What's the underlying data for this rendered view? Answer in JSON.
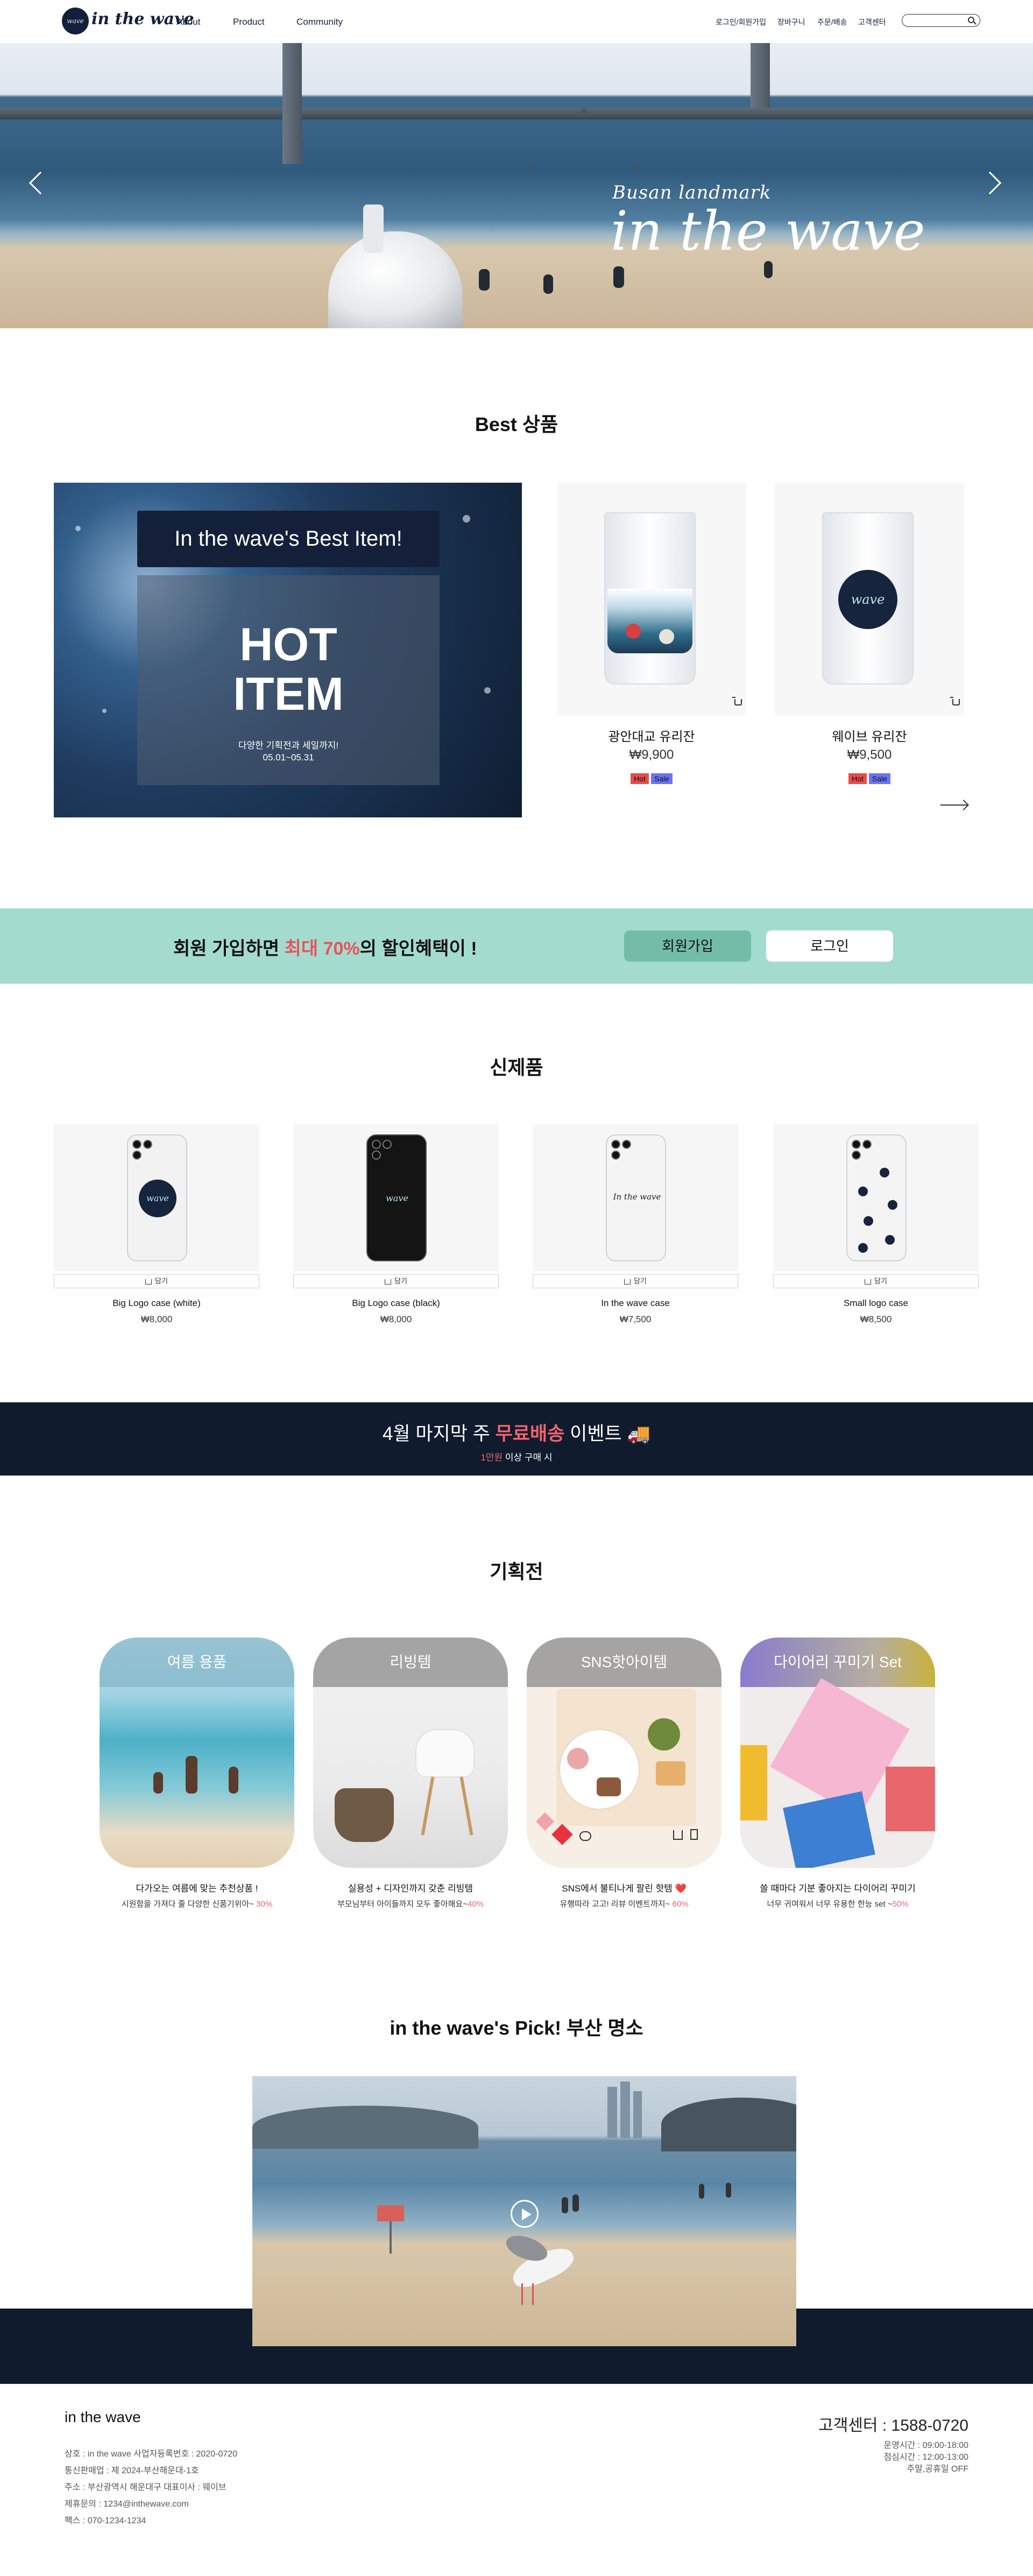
{
  "header": {
    "logo_text": "in the wave",
    "logo_badge": "wave",
    "nav": [
      "About",
      "Product",
      "Community"
    ],
    "util": [
      "로그인/회원가입",
      "장바구니",
      "주문/배송",
      "고객센터"
    ],
    "search_placeholder": ""
  },
  "hero": {
    "caption_small": "Busan landmark",
    "caption_big": "in the wave"
  },
  "best": {
    "title": "Best 상품",
    "banner_pill": "In the wave's Best Item!",
    "banner_hot": "HOT\nITEM",
    "banner_hot_line1": "HOT",
    "banner_hot_line2": "ITEM",
    "banner_sub1": "다양한 기획전과 세일까지!",
    "banner_sub2": "05.01~05.31",
    "products": [
      {
        "name": "광안대교 유리잔",
        "price": "₩9,900",
        "tags": [
          "Hot",
          "Sale"
        ]
      },
      {
        "name": "웨이브 유리잔",
        "price": "₩9,500",
        "tags": [
          "Hot",
          "Sale"
        ]
      }
    ],
    "glass_badge": "wave"
  },
  "member": {
    "text_before": "회원 가입하면 ",
    "text_highlight": "최대 70%",
    "text_after": "의 할인혜택이 !",
    "join_label": "회원가입",
    "login_label": "로그인"
  },
  "new_products": {
    "title": "신제품",
    "cart_label": "담기",
    "items": [
      {
        "name": "Big Logo case (white)",
        "price": "₩8,000",
        "logo": "wave"
      },
      {
        "name": "Big Logo case (black)",
        "price": "₩8,000",
        "logo": "wave"
      },
      {
        "name": "In the wave case",
        "price": "₩7,500",
        "logo": "In the wave"
      },
      {
        "name": "Small logo case",
        "price": "₩8,500",
        "logo": ""
      }
    ]
  },
  "event": {
    "title_before": "4월 마지막 주 ",
    "title_highlight": "무료배송",
    "title_after": " 이벤트 🚚",
    "sub_highlight": "1만원",
    "sub_after": " 이상 구매 시"
  },
  "plan": {
    "title": "기획전",
    "cards": [
      {
        "label": "여름 용품",
        "title": "다가오는 여름에 맞는 추천상품 !",
        "sub": "시원함을 가져다 줄 다양한 신품기위아~ ",
        "discount": "30%"
      },
      {
        "label": "리빙템",
        "title": "실용성 + 디자인까지 갖춘 리빙템",
        "sub": "부모님부터 아이들까지 모두 좋아해요~",
        "discount": "40%"
      },
      {
        "label": "SNS핫아이템",
        "title": "SNS에서 불티나게 팔린 핫템 ❤️",
        "sub": "유행따라 고고! 리뷰 이벤트까지~ ",
        "discount": "60%"
      },
      {
        "label": "다이어리 꾸미기 Set",
        "title": "쓸 때마다 기분 좋아지는 다이어리 꾸미기",
        "sub": "너무 귀여워서 너무 유용한 한능 set ~",
        "discount": "50%"
      }
    ]
  },
  "pick": {
    "title": "in the wave's Pick!  부산 명소"
  },
  "footer": {
    "brand": "in the wave",
    "lines": [
      "상호 : in the wave     사업자등록번호 : 2020-0720",
      "통신판매업 : 제 2024-부산해운대-1호",
      "주소 : 부산광역시 해운대구     대표이사 : 웨이브",
      "제휴문의 : 1234@inthewave.com",
      "팩스 : 070-1234-1234"
    ],
    "cs": "고객센터 : 1588-0720",
    "hours": [
      "운영시간 : 09:00-18:00",
      "점심시간 : 12:00-13:00",
      "주말,공휴일 OFF"
    ]
  },
  "colors": {
    "navy": "#111b2e",
    "mint": "#a3dccf",
    "mint_button": "#73bda8",
    "accent_red": "#f1646b",
    "hot_tag": "#e84c4c",
    "sale_tag": "#6b73f2"
  }
}
